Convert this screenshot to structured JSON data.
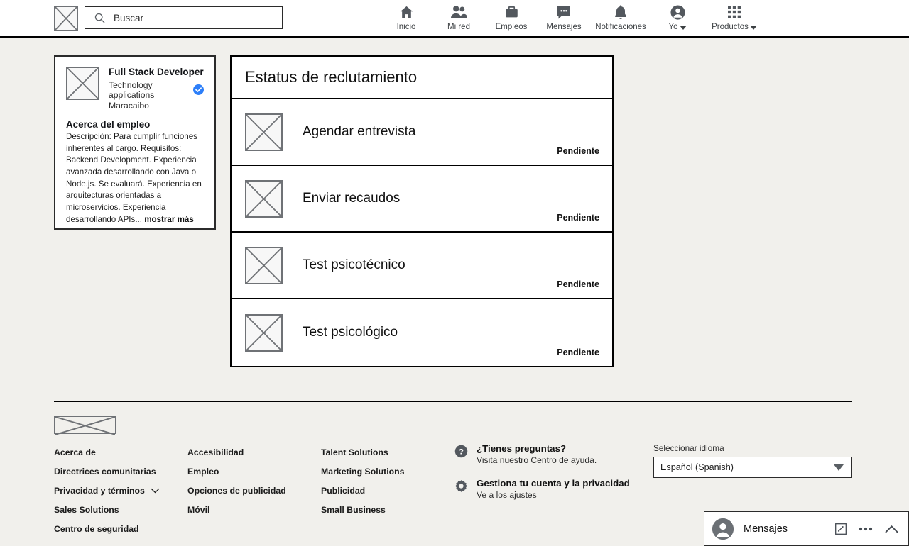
{
  "header": {
    "logo_icon": "placeholder-logo-icon",
    "search": {
      "icon": "search-icon",
      "placeholder": "Buscar",
      "value": ""
    },
    "nav": [
      {
        "icon": "home-icon",
        "label": "Inicio",
        "has_caret": false
      },
      {
        "icon": "people-icon",
        "label": "Mi red",
        "has_caret": false
      },
      {
        "icon": "briefcase-icon",
        "label": "Empleos",
        "has_caret": false
      },
      {
        "icon": "message-bubble-icon",
        "label": "Mensajes",
        "has_caret": false
      },
      {
        "icon": "bell-icon",
        "label": "Notificaciones",
        "has_caret": false
      },
      {
        "icon": "account-circle-icon",
        "label": "Yo",
        "has_caret": true
      },
      {
        "icon": "grid-apps-icon",
        "label": "Productos",
        "has_caret": true
      }
    ]
  },
  "job_card": {
    "thumbnail_icon": "image-placeholder-icon",
    "title": "Full Stack Developer",
    "company": "Technology applications",
    "verified_icon": "verified-badge-icon",
    "location": "Maracaibo",
    "about_heading": "Acerca del empleo",
    "about_body": "Descripción: Para cumplir funciones inherentes al cargo. Requisitos: Backend Development. Experiencia avanzada desarrollando con Java o Node.js. Se evaluará. Experiencia en arquitecturas orientadas a microservicios. Experiencia desarrollando APIs...",
    "show_more": "mostrar más"
  },
  "status_panel": {
    "title": "Estatus de reclutamiento",
    "rows": [
      {
        "icon": "image-placeholder-icon",
        "label": "Agendar entrevista",
        "status": "Pendiente"
      },
      {
        "icon": "image-placeholder-icon",
        "label": "Enviar recaudos",
        "status": "Pendiente"
      },
      {
        "icon": "image-placeholder-icon",
        "label": "Test psicotécnico",
        "status": "Pendiente"
      },
      {
        "icon": "image-placeholder-icon",
        "label": "Test psicológico",
        "status": "Pendiente"
      }
    ]
  },
  "footer": {
    "logo_icon": "footer-logo-icon",
    "columns": [
      {
        "links": [
          {
            "label": "Acerca de",
            "chevron": false
          },
          {
            "label": "Directrices comunitarias",
            "chevron": false
          },
          {
            "label": "Privacidad y términos",
            "chevron": true
          },
          {
            "label": "Sales Solutions",
            "chevron": false
          },
          {
            "label": "Centro de seguridad",
            "chevron": false
          }
        ]
      },
      {
        "links": [
          {
            "label": "Accesibilidad",
            "chevron": false
          },
          {
            "label": "Empleo",
            "chevron": false
          },
          {
            "label": "Opciones de publicidad",
            "chevron": false
          },
          {
            "label": "Móvil",
            "chevron": false
          }
        ]
      },
      {
        "links": [
          {
            "label": "Talent Solutions",
            "chevron": false
          },
          {
            "label": "Marketing Solutions",
            "chevron": false
          },
          {
            "label": "Publicidad",
            "chevron": false
          },
          {
            "label": "Small Business",
            "chevron": false
          }
        ]
      }
    ],
    "help": [
      {
        "icon": "question-mark-circle-icon",
        "title": "¿Tienes preguntas?",
        "subtitle": "Visita nuestro Centro de ayuda."
      },
      {
        "icon": "gear-icon",
        "title": "Gestiona tu cuenta y la privacidad",
        "subtitle": "Ve a los ajustes"
      }
    ],
    "language": {
      "label": "Seleccionar idioma",
      "selected": "Español (Spanish)",
      "arrow_icon": "chevron-down-icon"
    }
  },
  "messaging_widget": {
    "avatar_icon": "avatar-icon",
    "label": "Mensajes",
    "actions": [
      {
        "icon": "compose-icon"
      },
      {
        "icon": "overflow-menu-icon"
      },
      {
        "icon": "chevron-up-icon"
      }
    ]
  },
  "colors": {
    "page_background": "#f1f0ec",
    "surface": "#ffffff",
    "border_strong": "#000000",
    "border_placeholder": "#6f7276",
    "icon_gray": "#53585e",
    "verified_blue": "#2d7ff9",
    "text_primary": "#111111"
  }
}
